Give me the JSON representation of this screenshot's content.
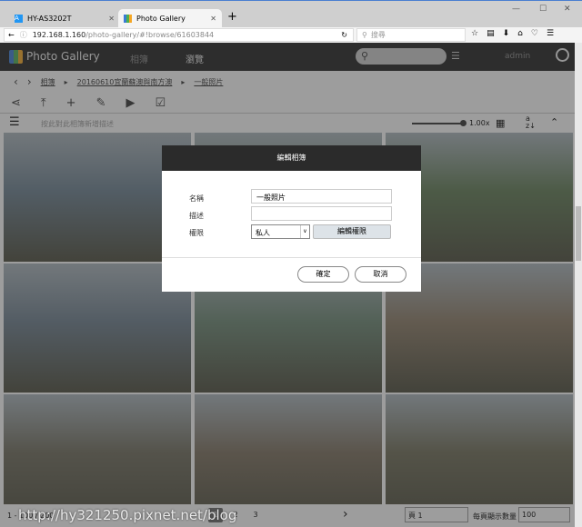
{
  "browser": {
    "tabs": [
      {
        "label": "HY-AS3202T"
      },
      {
        "label": "Photo Gallery"
      }
    ],
    "url_host": "192.168.1.160",
    "url_path": "/photo-gallery/#!browse/61603844",
    "search_placeholder": "搜尋"
  },
  "header": {
    "brand": "Photo Gallery",
    "nav": [
      "相簿",
      "瀏覽"
    ],
    "user": "admin"
  },
  "breadcrumb": [
    "相簿",
    "20160610宜蘭蘇澳與南方澳",
    "一般照片"
  ],
  "desc_placeholder": "按此對此相簿新增描述",
  "zoom_level": "1.00x",
  "photo_colors": [
    "#6a7f8f",
    "#6f8a6f",
    "#5e7a52",
    "#6b7d8c",
    "#6a8672",
    "#8a7a64",
    "#6d6a5a",
    "#7a6e5c",
    "#6d6b55"
  ],
  "footer": {
    "count": "1 - 100 / 200",
    "pages": [
      "1",
      "2",
      "3"
    ],
    "page_select": "頁 1",
    "per_page_label": "每頁顯示數量",
    "per_page": "100"
  },
  "dialog": {
    "title": "編輯相簿",
    "name_label": "名稱",
    "name_value": "一般照片",
    "desc_label": "描述",
    "desc_value": "",
    "perm_label": "權限",
    "perm_value": "私人",
    "edit_perm": "編輯權限",
    "ok": "確定",
    "cancel": "取消"
  },
  "watermark": "http://hy321250.pixnet.net/blog"
}
